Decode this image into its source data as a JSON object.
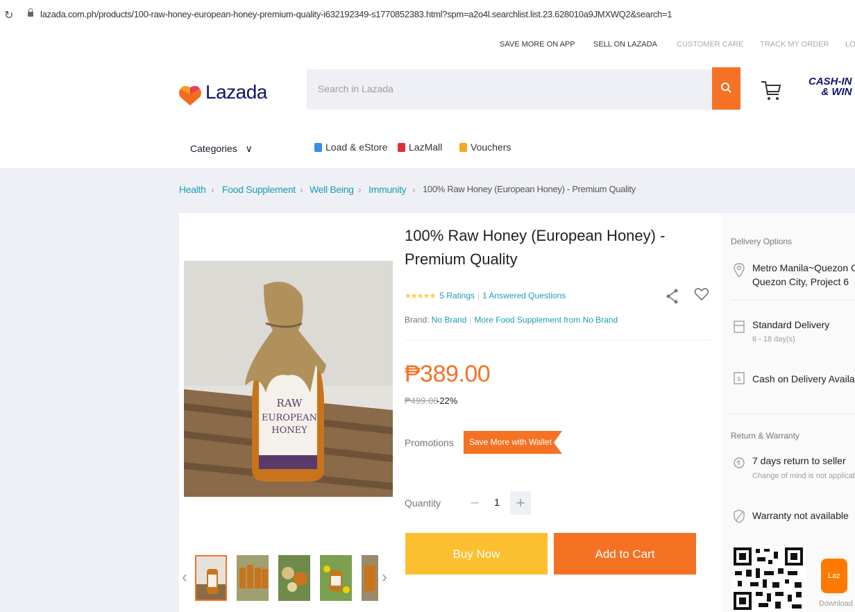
{
  "browser": {
    "url": "lazada.com.ph/products/100-raw-honey-european-honey-premium-quality-i632192349-s1770852383.html?spm=a2o4l.searchlist.list.23.628010a9JMXWQ2&search=1"
  },
  "top_links": {
    "save_more": "SAVE MORE ON APP",
    "sell": "SELL ON LAZADA",
    "customer_care": "CUSTOMER CARE",
    "track_order": "TRACK MY ORDER",
    "login_partial": "LO"
  },
  "header": {
    "logo": "Lazada",
    "search_placeholder": "Search in Lazada",
    "promo_line1": "CASH-IN",
    "promo_line2": "& WIN"
  },
  "nav": {
    "categories": "Categories",
    "load": "Load & eStore",
    "lazmall": "LazMall",
    "vouchers": "Vouchers"
  },
  "breadcrumb": [
    "Health",
    "Food Supplement",
    "Well Being",
    "Immunity",
    "100% Raw Honey (European Honey) - Premium Quality"
  ],
  "product": {
    "title": "100% Raw Honey (European Honey) - Premium Quality",
    "ratings": "5 Ratings",
    "answered": "1 Answered Questions",
    "brand_label": "Brand:",
    "brand_value": "No Brand",
    "more_from": "More Food Supplement from No Brand",
    "price": "₱389.00",
    "original_price": "₱499.00",
    "discount": "-22%",
    "promotions_label": "Promotions",
    "promo_tag": "Save More with Wallet",
    "quantity_label": "Quantity",
    "quantity": "1",
    "buy_now": "Buy Now",
    "add_to_cart": "Add to Cart",
    "label_line1": "RAW",
    "label_line2": "EUROPEAN",
    "label_line3": "HONEY"
  },
  "delivery": {
    "heading": "Delivery Options",
    "location_line1": "Metro Manila~Quezon City,",
    "location_line2": "Quezon City, Project 6",
    "standard": "Standard Delivery",
    "standard_days": "6 - 18 day(s)",
    "cod": "Cash on Delivery Available",
    "rw_heading": "Return & Warranty",
    "return": "7 days return to seller",
    "return_sub": "Change of mind is not applicable",
    "warranty": "Warranty not available",
    "app_badge": "Laz",
    "download": "Download"
  },
  "colors": {
    "accent": "#f57224",
    "buy": "#fcbf2f",
    "link": "#1a9cb7",
    "brand_navy": "#0f146d"
  }
}
